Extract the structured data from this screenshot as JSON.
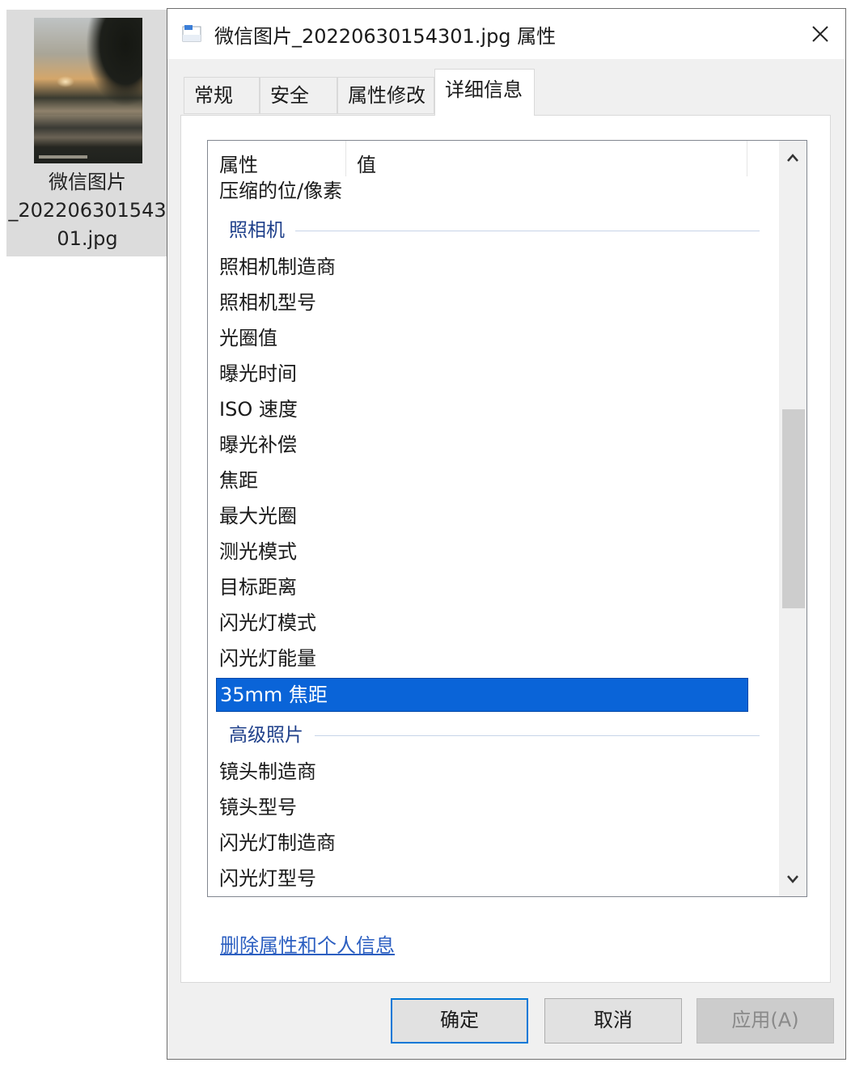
{
  "desktop": {
    "file_name_lines": [
      "微信图片",
      "_202206301543",
      "01.jpg"
    ]
  },
  "dialog": {
    "title": "微信图片_20220630154301.jpg 属性",
    "tabs": [
      "常规",
      "安全",
      "属性修改",
      "详细信息"
    ],
    "active_tab": "详细信息",
    "columns": {
      "property": "属性",
      "value": "值"
    },
    "rows_top": [
      "压缩的位/像素"
    ],
    "group_camera": "照相机",
    "camera_rows": [
      "照相机制造商",
      "照相机型号",
      "光圈值",
      "曝光时间",
      "ISO 速度",
      "曝光补偿",
      "焦距",
      "最大光圈",
      "测光模式",
      "目标距离",
      "闪光灯模式",
      "闪光灯能量",
      "35mm 焦距"
    ],
    "selected_row": "35mm 焦距",
    "group_advanced": "高级照片",
    "advanced_rows": [
      "镜头制造商",
      "镜头型号",
      "闪光灯制造商",
      "闪光灯型号"
    ],
    "remove_link": "删除属性和个人信息",
    "buttons": {
      "ok": "确定",
      "cancel": "取消",
      "apply": "应用(A)"
    },
    "accent_color": "#0a64d8"
  }
}
